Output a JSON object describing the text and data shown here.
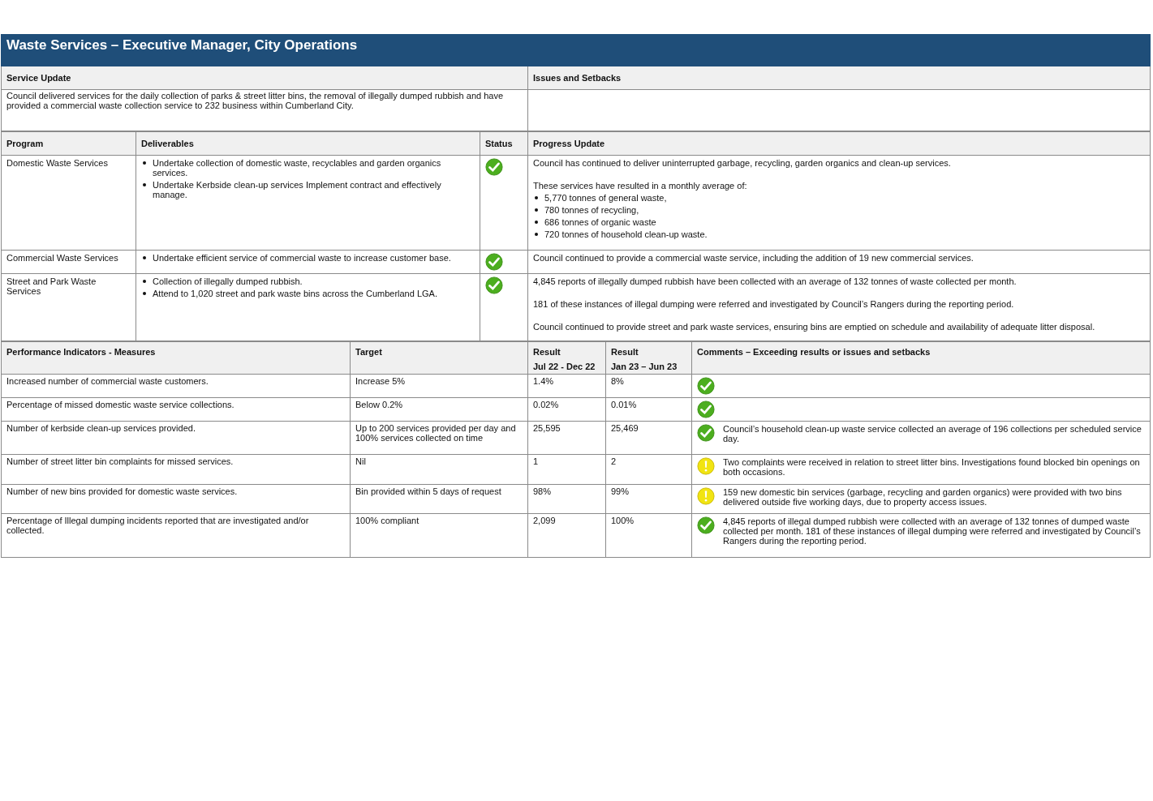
{
  "title": "Waste Services – Executive Manager, City Operations",
  "service_update": {
    "heading": "Service Update",
    "text": "Council delivered services for the daily collection of parks & street litter bins, the removal of illegally dumped rubbish and have provided a commercial waste collection service to 232 business within Cumberland City."
  },
  "issues": {
    "heading": "Issues and Setbacks"
  },
  "programs": {
    "columns": [
      "Program",
      "Deliverables",
      "Status",
      "Progress Update"
    ],
    "rows": [
      {
        "program": "Domestic Waste Services",
        "deliverables": [
          "Undertake collection of domestic waste, recyclables and garden organics services.",
          "Undertake Kerbside clean-up services Implement contract and effectively manage."
        ],
        "on_track": true,
        "progress": [
          {
            "kind": "text",
            "text": "Council has continued to deliver uninterrupted garbage, recycling, garden organics and clean-up services."
          },
          {
            "kind": "text",
            "text": "These services have resulted in a monthly average of:"
          },
          {
            "kind": "list",
            "items": [
              "5,770 tonnes of general waste,",
              "780 tonnes of recycling,",
              "686 tonnes of organic waste",
              "720 tonnes of household clean-up waste."
            ]
          }
        ]
      },
      {
        "program": "Commercial Waste Services",
        "deliverables": [
          "Undertake efficient service of commercial waste to increase customer base."
        ],
        "on_track": true,
        "progress": [
          {
            "kind": "text",
            "text": "Council continued to provide a commercial waste service, including the addition of 19 new commercial services."
          }
        ]
      },
      {
        "program": "Street and Park Waste Services",
        "deliverables": [
          "Collection of illegally dumped rubbish.",
          "Attend to 1,020 street and park waste bins across the Cumberland LGA."
        ],
        "on_track": true,
        "progress": [
          {
            "kind": "text",
            "text": "4,845 reports of illegally dumped rubbish have been collected with an average of 132 tonnes of waste collected per month."
          },
          {
            "kind": "text",
            "text": "181 of these instances of illegal dumping were referred and investigated by Council’s Rangers during the reporting period."
          },
          {
            "kind": "text",
            "text": "Council continued to provide street and park waste services, ensuring bins are emptied on schedule and availability of adequate litter disposal."
          }
        ]
      }
    ]
  },
  "indicators": {
    "columns": [
      {
        "title": "Performance Indicators - Measures"
      },
      {
        "title": "Target"
      },
      {
        "title": "Result",
        "period": "Jul 22 - Dec 22"
      },
      {
        "title": "Result",
        "period": "Jan 23 – Jun 23"
      },
      {
        "title": "Comments – Exceeding results or issues and setbacks"
      }
    ],
    "rows": [
      {
        "measure": "Increased number of commercial waste customers.",
        "target": "Increase 5%",
        "result_1": "1.4%",
        "result_2": "8%",
        "on_track": true
      },
      {
        "measure": "Percentage of missed domestic waste service collections.",
        "target": "Below 0.2%",
        "result_1": "0.02%",
        "result_2": "0.01%",
        "on_track": true
      },
      {
        "measure": "Number of kerbside clean-up services provided.",
        "target": "Up to 200 services provided  per day and 100% services collected on time",
        "result_1": "25,595",
        "result_2": "25,469",
        "on_track": true,
        "comment": "Council’s household clean-up waste service collected an average of 196 collections per scheduled service day."
      },
      {
        "measure": "Number of street litter bin complaints for missed services.",
        "target": "Nil",
        "result_1": "1",
        "result_2": "2",
        "on_track": false,
        "comment": "Two complaints were received in relation to street litter bins. Investigations found blocked bin openings on both occasions."
      },
      {
        "measure": "Number of new bins provided for domestic waste services.",
        "target": "Bin provided within 5 days of request",
        "result_1": "98%",
        "result_2": "99%",
        "on_track": false,
        "comment": "159 new domestic bin services (garbage, recycling and garden organics) were provided with two bins delivered outside five working days, due to property access issues."
      },
      {
        "measure": "Percentage of Illegal dumping incidents reported that are investigated and/or collected.",
        "target": "100% compliant",
        "result_1": "2,099",
        "result_2": "100%",
        "on_track": true,
        "comment": "4,845 reports of illegal dumped rubbish were collected with an average of 132 tonnes of dumped waste collected per month. 181 of these instances of illegal dumping were referred and investigated by Council’s Rangers during the reporting period."
      }
    ]
  }
}
